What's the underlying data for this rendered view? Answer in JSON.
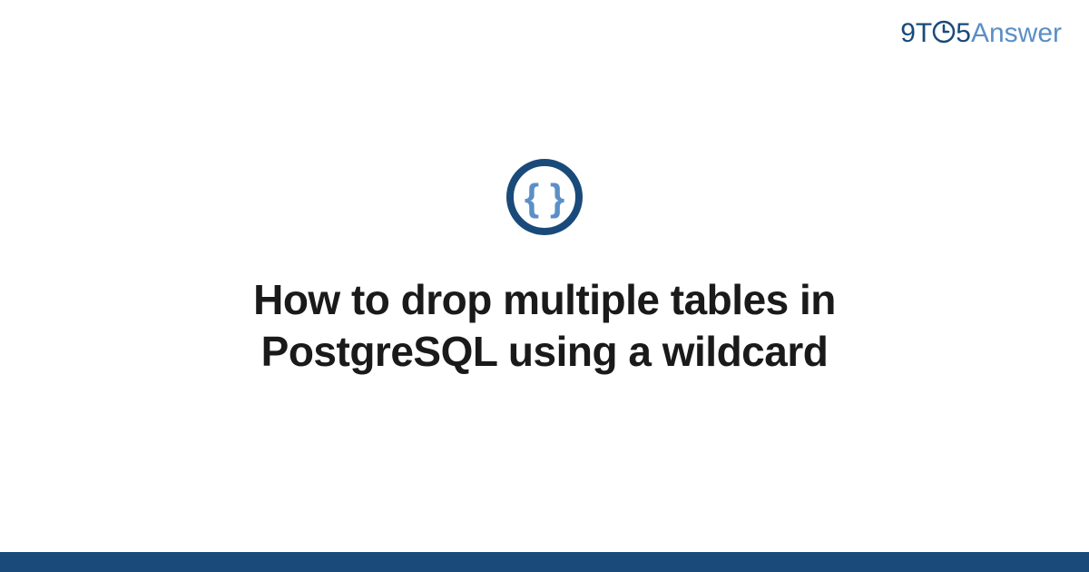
{
  "brand": {
    "part1": "9T",
    "part2": "5",
    "part3": "Answer"
  },
  "content": {
    "title": "How to drop multiple tables in PostgreSQL using a wildcard"
  },
  "colors": {
    "primary": "#194a7a",
    "accent": "#5a8fc7",
    "iconInner": "#5a8fc7",
    "iconRing": "#194a7a"
  }
}
